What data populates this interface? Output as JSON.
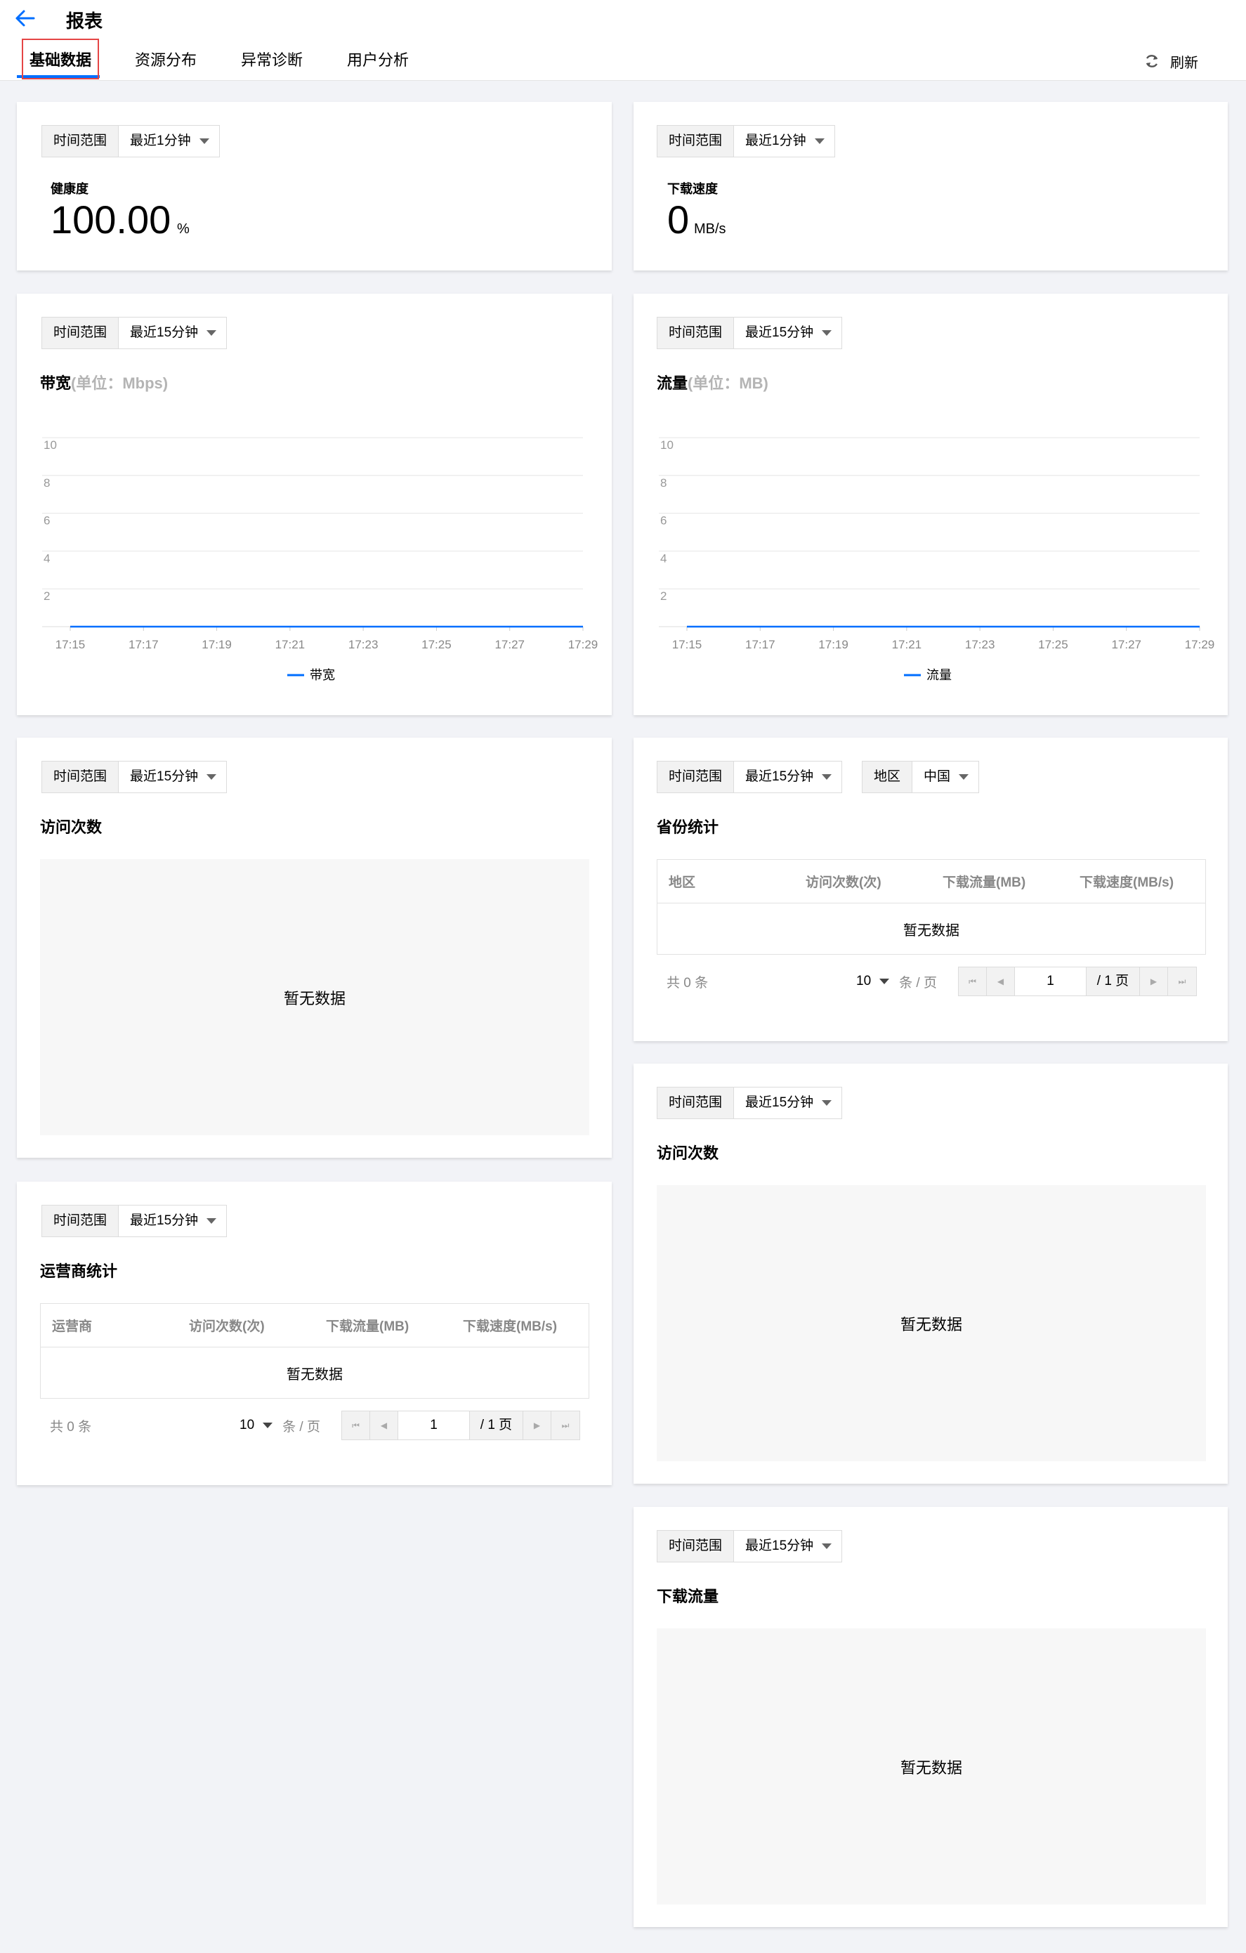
{
  "header": {
    "title": "报表",
    "tabs": [
      {
        "label": "基础数据"
      },
      {
        "label": "资源分布"
      },
      {
        "label": "异常诊断"
      },
      {
        "label": "用户分析"
      }
    ],
    "refresh_label": "刷新"
  },
  "filters": {
    "time_label": "时间范围",
    "last_1min": "最近1分钟",
    "last_15min": "最近15分钟",
    "region_label": "地区",
    "region_value": "中国"
  },
  "health": {
    "label": "健康度",
    "value": "100.00",
    "unit": "%"
  },
  "download_speed": {
    "label": "下载速度",
    "value": "0",
    "unit": "MB/s"
  },
  "bandwidth": {
    "title": "带宽",
    "unit": "(单位：Mbps)",
    "legend": "带宽"
  },
  "traffic": {
    "title": "流量",
    "unit": "(单位：MB)",
    "legend": "流量"
  },
  "visits_left": {
    "title": "访问次数",
    "empty": "暂无数据"
  },
  "visits_right": {
    "title": "访问次数",
    "empty": "暂无数据"
  },
  "download_traffic": {
    "title": "下载流量",
    "empty": "暂无数据"
  },
  "province": {
    "title": "省份统计",
    "columns": [
      "地区",
      "访问次数(次)",
      "下载流量(MB)",
      "下载速度(MB/s)"
    ],
    "empty": "暂无数据",
    "pager": {
      "total": "共 0 条",
      "page_size": "10",
      "page_size_unit": "条 / 页",
      "page": "1",
      "page_total": "/ 1 页"
    }
  },
  "isp": {
    "title": "运营商统计",
    "columns": [
      "运营商",
      "访问次数(次)",
      "下载流量(MB)",
      "下载速度(MB/s)"
    ],
    "empty": "暂无数据",
    "pager": {
      "total": "共 0 条",
      "page_size": "10",
      "page_size_unit": "条 / 页",
      "page": "1",
      "page_total": "/ 1 页"
    }
  },
  "colors": {
    "accent": "#006eff",
    "highlight": "#e54545"
  },
  "chart_data": [
    {
      "type": "line",
      "title": "带宽",
      "ylabel": "单位：Mbps",
      "x": [
        "17:15",
        "17:17",
        "17:19",
        "17:21",
        "17:23",
        "17:25",
        "17:27",
        "17:29"
      ],
      "yticks": [
        2,
        4,
        6,
        8,
        10
      ],
      "ylim": [
        0,
        10
      ],
      "series": [
        {
          "name": "带宽",
          "values": [
            0,
            0,
            0,
            0,
            0,
            0,
            0,
            0
          ]
        }
      ],
      "grid": true,
      "legend": "bottom"
    },
    {
      "type": "line",
      "title": "流量",
      "ylabel": "单位：MB",
      "x": [
        "17:15",
        "17:17",
        "17:19",
        "17:21",
        "17:23",
        "17:25",
        "17:27",
        "17:29"
      ],
      "yticks": [
        2,
        4,
        6,
        8,
        10
      ],
      "ylim": [
        0,
        10
      ],
      "series": [
        {
          "name": "流量",
          "values": [
            0,
            0,
            0,
            0,
            0,
            0,
            0,
            0
          ]
        }
      ],
      "grid": true,
      "legend": "bottom"
    }
  ]
}
